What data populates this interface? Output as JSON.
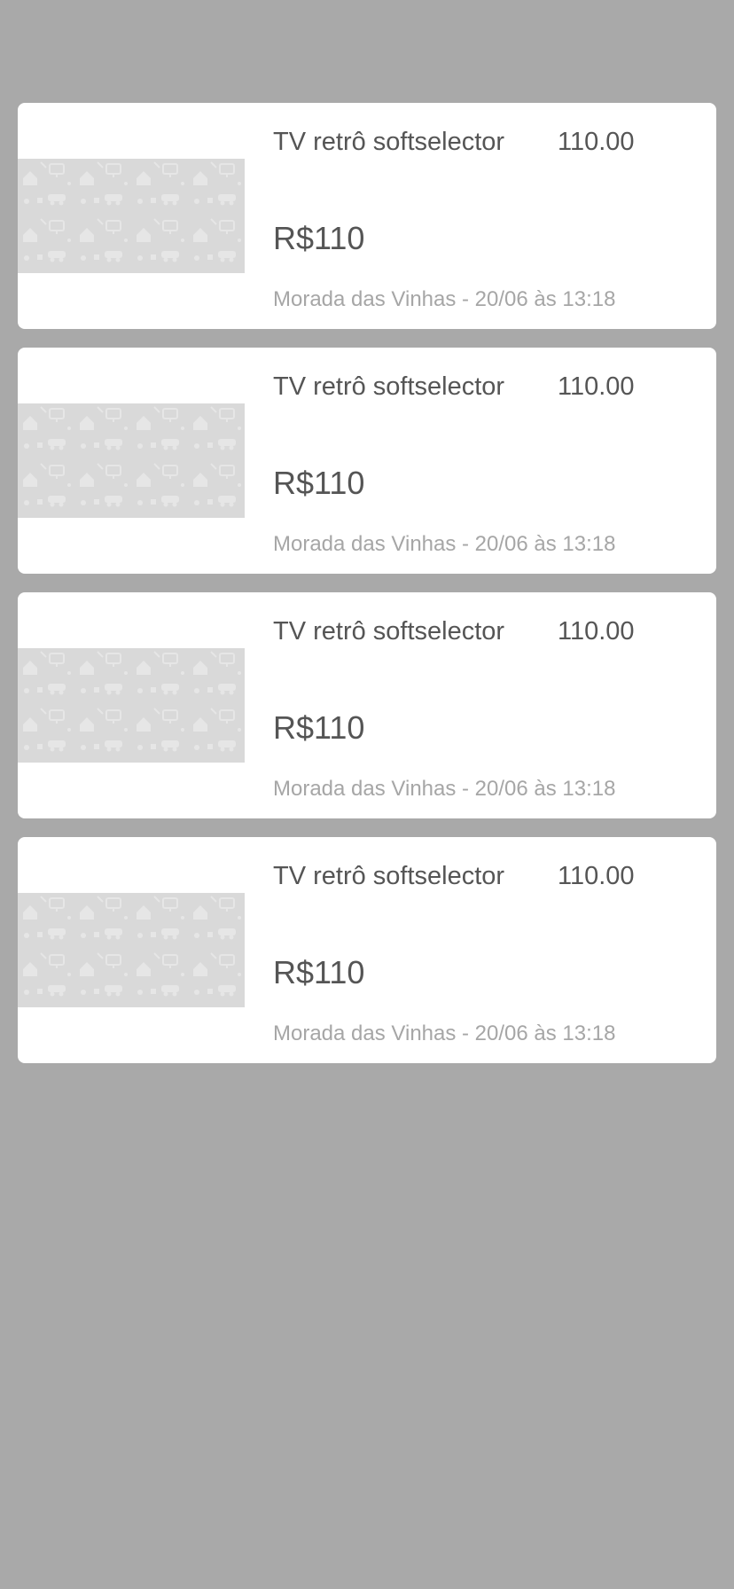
{
  "listings": [
    {
      "title": "TV retrô softselector",
      "amount": "110.00",
      "price": "R$110",
      "location_date": "Morada das Vinhas - 20/06 às 13:18",
      "thumbnail_icon": "placeholder-pattern-icon"
    },
    {
      "title": "TV retrô softselector",
      "amount": "110.00",
      "price": "R$110",
      "location_date": "Morada das Vinhas - 20/06 às 13:18",
      "thumbnail_icon": "placeholder-pattern-icon"
    },
    {
      "title": "TV retrô softselector",
      "amount": "110.00",
      "price": "R$110",
      "location_date": "Morada das Vinhas - 20/06 às 13:18",
      "thumbnail_icon": "placeholder-pattern-icon"
    },
    {
      "title": "TV retrô softselector",
      "amount": "110.00",
      "price": "R$110",
      "location_date": "Morada das Vinhas - 20/06 às 13:18",
      "thumbnail_icon": "placeholder-pattern-icon"
    }
  ],
  "colors": {
    "background": "#a9a9a9",
    "card": "#ffffff",
    "placeholder": "#d9d9d9",
    "text_primary": "#555555",
    "text_secondary": "#a6a6a6"
  }
}
